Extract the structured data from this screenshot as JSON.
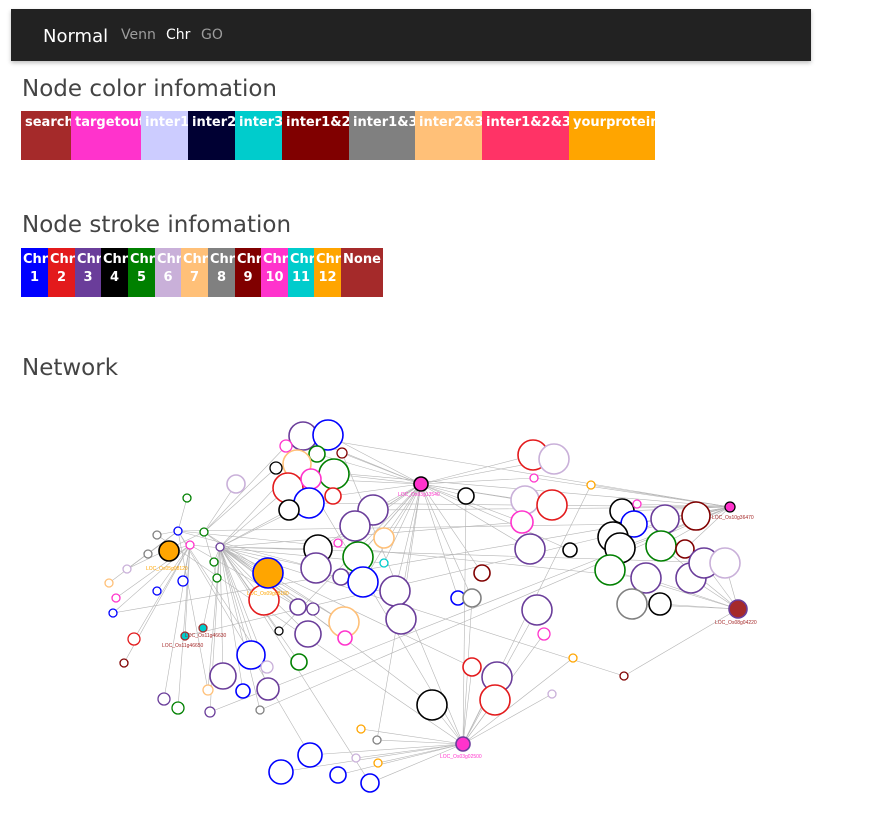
{
  "navbar": {
    "brand": "Normal",
    "links": [
      {
        "label": "Venn",
        "active": false
      },
      {
        "label": "Chr",
        "active": true
      },
      {
        "label": "GO",
        "active": false
      }
    ]
  },
  "color_section": {
    "title": "Node color infomation",
    "items": [
      {
        "label": "search",
        "color": "#a52a2a"
      },
      {
        "label": "targetout",
        "color": "#ff33cc"
      },
      {
        "label": "inter1",
        "color": "#ccccff"
      },
      {
        "label": "inter2",
        "color": "#000033"
      },
      {
        "label": "inter3",
        "color": "#00cccc"
      },
      {
        "label": "inter1&2",
        "color": "#800000"
      },
      {
        "label": "inter1&3",
        "color": "#808080"
      },
      {
        "label": "inter2&3",
        "color": "#ffc078"
      },
      {
        "label": "inter1&2&3",
        "color": "#ff3366"
      },
      {
        "label": "yourprotein",
        "color": "#ffa500"
      }
    ]
  },
  "stroke_section": {
    "title": "Node stroke infomation",
    "items": [
      {
        "top": "Chr",
        "bottom": "1",
        "color": "#0000ff"
      },
      {
        "top": "Chr",
        "bottom": "2",
        "color": "#e31a1c"
      },
      {
        "top": "Chr",
        "bottom": "3",
        "color": "#6a3d9a"
      },
      {
        "top": "Chr",
        "bottom": "4",
        "color": "#000000"
      },
      {
        "top": "Chr",
        "bottom": "5",
        "color": "#008000"
      },
      {
        "top": "Chr",
        "bottom": "6",
        "color": "#c9b0d9"
      },
      {
        "top": "Chr",
        "bottom": "7",
        "color": "#ffc078"
      },
      {
        "top": "Chr",
        "bottom": "8",
        "color": "#808080"
      },
      {
        "top": "Chr",
        "bottom": "9",
        "color": "#800000"
      },
      {
        "top": "Chr",
        "bottom": "10",
        "color": "#ff33cc"
      },
      {
        "top": "Chr",
        "bottom": "11",
        "color": "#00cccc"
      },
      {
        "top": "Chr",
        "bottom": "12",
        "color": "#ffa500"
      },
      {
        "top": "None",
        "bottom": "",
        "color": "#a52a2a"
      }
    ]
  },
  "network_section": {
    "title": "Network",
    "hub_labels": [
      "LOC_Os03g13540",
      "LOC_Os10g36470",
      "LOC_Os08g04220",
      "LOC_Os03g02500",
      "LOC_Os11g46650",
      "LOC_Os11g46630",
      "LOC_Os05g08120",
      "LOC_Os09g08180"
    ]
  }
}
